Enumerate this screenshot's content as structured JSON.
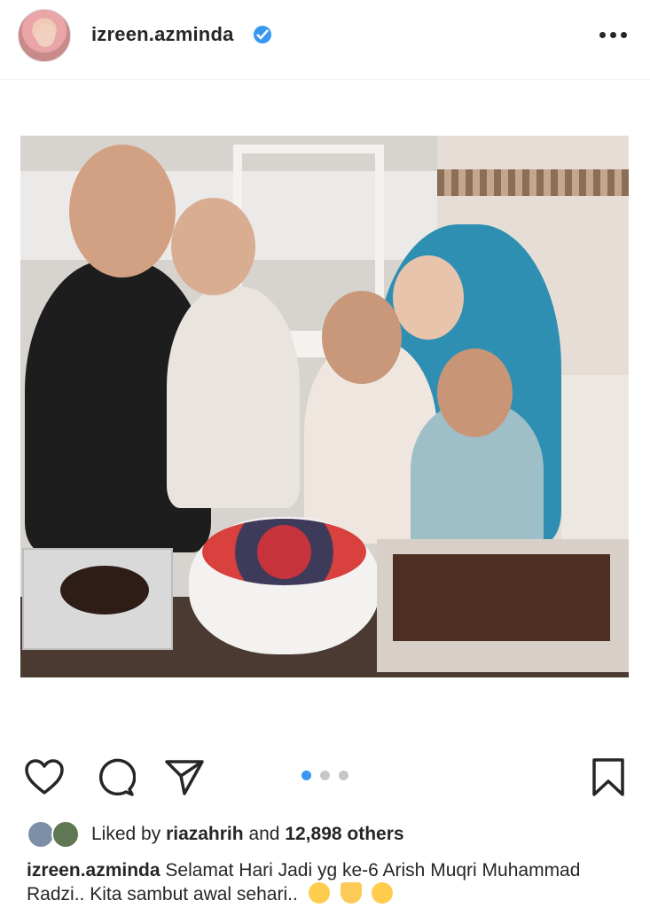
{
  "post": {
    "username": "izreen.azminda",
    "verified_icon": "verified-badge-icon",
    "more_icon": "more-options-icon",
    "accent": "#3897f0"
  },
  "actions": {
    "like_icon": "heart-icon",
    "comment_icon": "comment-icon",
    "share_icon": "send-icon",
    "save_icon": "bookmark-icon",
    "carousel": {
      "total": 3,
      "active": 1,
      "active_color": "#3897f0"
    }
  },
  "likes": {
    "prefix": "Liked by",
    "user": "riazahrih",
    "connector": "and",
    "count": "12,898 others"
  },
  "caption": {
    "username": "izreen.azminda",
    "text": "Selamat Hari Jadi yg ke-6 Arish Muqri Muhammad Radzi.. Kita sambut awal sehari..",
    "emojis": [
      "kissing-face-emoji",
      "yellow-heart-emoji",
      "hugging-face-emoji"
    ]
  }
}
